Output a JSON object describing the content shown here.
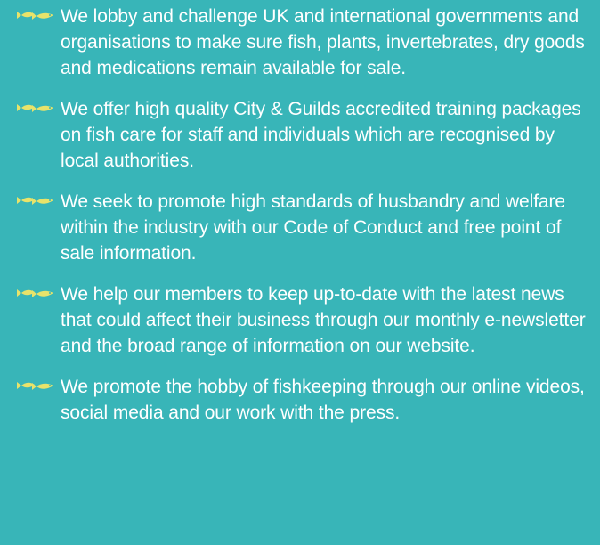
{
  "list": {
    "bullet_icon": "fish-icon",
    "items": [
      {
        "text": "We lobby and challenge UK and international governments and organisations to make sure fish, plants, invertebrates, dry goods and medications remain available for sale."
      },
      {
        "text": "We offer high quality City & Guilds accredited training packages on fish care for staff and individuals which are recognised by local authorities."
      },
      {
        "text": "We seek to promote high standards of husbandry and welfare within the industry with our Code of Conduct and free point of sale information."
      },
      {
        "text": "We help our members to keep up-to-date with the latest news that could affect their business through our monthly e-newsletter and the broad range of information on our website."
      },
      {
        "text": "We promote the hobby of fishkeeping through our online videos, social media and our work with the press."
      }
    ]
  },
  "colors": {
    "background": "#38b5b8",
    "text": "#ffffff",
    "bullet": "#e8e36a"
  }
}
